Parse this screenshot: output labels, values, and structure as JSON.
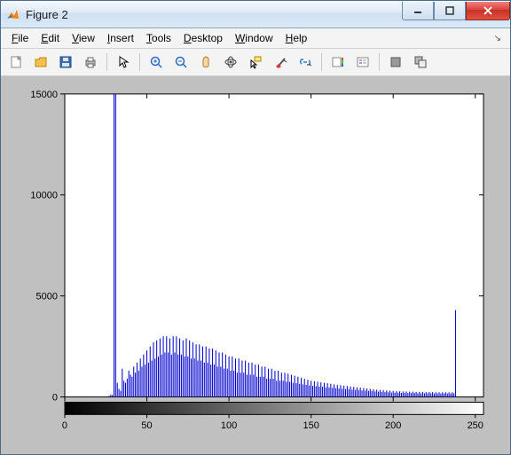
{
  "window": {
    "title": "Figure 2"
  },
  "menu": {
    "file": "File",
    "edit": "Edit",
    "view": "View",
    "insert": "Insert",
    "tools": "Tools",
    "desktop": "Desktop",
    "window": "Window",
    "help": "Help"
  },
  "toolbar_icons": {
    "new": "new-figure-icon",
    "open": "open-icon",
    "save": "save-icon",
    "print": "print-icon",
    "edit_plot": "pointer-icon",
    "zoom_in": "zoom-in-icon",
    "zoom_out": "zoom-out-icon",
    "pan": "pan-icon",
    "rotate": "rotate-3d-icon",
    "data_cursor": "data-cursor-icon",
    "brush": "brush-icon",
    "link": "link-icon",
    "colorbar": "insert-colorbar-icon",
    "legend": "insert-legend-icon",
    "hide": "hide-tools-icon",
    "show": "show-tools-icon"
  },
  "chart_data": {
    "type": "bar",
    "title": "",
    "xlabel": "",
    "ylabel": "",
    "xlim": [
      0,
      255
    ],
    "ylim": [
      0,
      15000
    ],
    "xticks": [
      0,
      50,
      100,
      150,
      200,
      250
    ],
    "yticks": [
      0,
      5000,
      10000,
      15000
    ],
    "grayscale_colorbar": true,
    "series": [
      {
        "name": "histogram",
        "x_start": 0,
        "x_step": 1,
        "values": [
          0,
          0,
          0,
          0,
          0,
          0,
          0,
          0,
          0,
          0,
          0,
          0,
          0,
          0,
          0,
          0,
          0,
          0,
          0,
          0,
          0,
          0,
          0,
          0,
          0,
          0,
          0,
          50,
          120,
          100,
          15000,
          15000,
          700,
          400,
          300,
          1400,
          800,
          700,
          900,
          1300,
          1100,
          1000,
          1500,
          1200,
          1700,
          1300,
          1900,
          1500,
          2100,
          1600,
          2300,
          1700,
          2500,
          1800,
          2700,
          1900,
          2800,
          2000,
          2900,
          2100,
          3000,
          2200,
          3000,
          2200,
          2900,
          2100,
          3000,
          2200,
          3000,
          2100,
          2900,
          2100,
          2800,
          2000,
          2900,
          2000,
          2800,
          1900,
          2700,
          1900,
          2600,
          1800,
          2600,
          1800,
          2500,
          1700,
          2500,
          1700,
          2400,
          1600,
          2400,
          1600,
          2300,
          1500,
          2200,
          1500,
          2200,
          1400,
          2100,
          1400,
          2000,
          1300,
          2000,
          1300,
          1900,
          1200,
          1900,
          1200,
          1800,
          1200,
          1800,
          1100,
          1700,
          1100,
          1700,
          1100,
          1600,
          1000,
          1600,
          1000,
          1500,
          1000,
          1500,
          900,
          1400,
          900,
          1400,
          900,
          1300,
          800,
          1300,
          800,
          1200,
          800,
          1200,
          750,
          1150,
          750,
          1100,
          700,
          1050,
          680,
          1000,
          650,
          950,
          620,
          900,
          600,
          850,
          570,
          800,
          550,
          780,
          530,
          750,
          510,
          720,
          500,
          700,
          480,
          680,
          470,
          650,
          450,
          620,
          430,
          600,
          420,
          580,
          400,
          560,
          390,
          540,
          380,
          520,
          360,
          500,
          350,
          480,
          340,
          460,
          320,
          440,
          310,
          420,
          300,
          400,
          290,
          380,
          270,
          360,
          260,
          350,
          250,
          340,
          240,
          320,
          230,
          310,
          220,
          300,
          210,
          290,
          210,
          280,
          200,
          270,
          200,
          270,
          190,
          260,
          190,
          260,
          190,
          250,
          180,
          250,
          180,
          250,
          180,
          240,
          180,
          240,
          180,
          240,
          170,
          230,
          170,
          230,
          170,
          230,
          170,
          230,
          170,
          230,
          170,
          230,
          180,
          4300,
          0,
          0,
          0,
          0,
          0,
          0,
          0,
          0,
          0,
          0,
          0,
          0,
          0,
          0,
          0,
          0,
          0
        ]
      }
    ]
  }
}
